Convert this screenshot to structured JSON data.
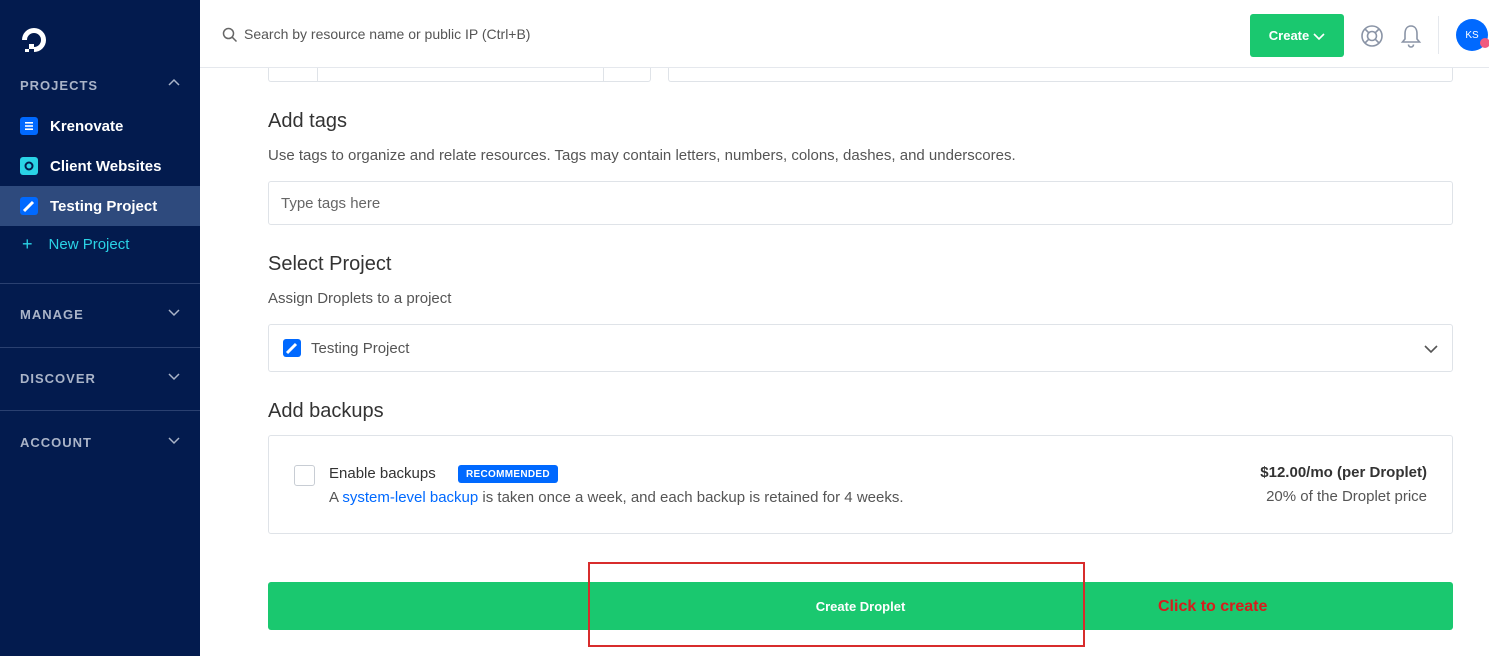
{
  "sidebar": {
    "logo_icon": "digitalocean-logo-icon",
    "projects_header": "PROJECTS",
    "projects": [
      {
        "label": "Krenovate",
        "icon": "project-list-icon",
        "color": "#0069ff"
      },
      {
        "label": "Client Websites",
        "icon": "project-web-icon",
        "color": "#2ad3e6"
      },
      {
        "label": "Testing Project",
        "icon": "project-pencil-icon",
        "color": "#0069ff",
        "active": true
      }
    ],
    "new_project_label": "New Project",
    "manage_header": "MANAGE",
    "discover_header": "DISCOVER",
    "account_header": "ACCOUNT"
  },
  "topbar": {
    "search_placeholder": "Search by resource name or public IP (Ctrl+B)",
    "create_label": "Create",
    "avatar_initials": "KS"
  },
  "tags": {
    "title": "Add tags",
    "description": "Use tags to organize and relate resources. Tags may contain letters, numbers, colons, dashes, and underscores.",
    "placeholder": "Type tags here"
  },
  "project_select": {
    "title": "Select Project",
    "description": "Assign Droplets to a project",
    "selected": "Testing Project"
  },
  "backups": {
    "title": "Add backups",
    "enable_label": "Enable backups",
    "badge": "RECOMMENDED",
    "desc_prefix": "A ",
    "desc_link": "system-level backup",
    "desc_suffix": " is taken once a week, and each backup is retained for 4 weeks.",
    "price": "$12.00/mo (per Droplet)",
    "price_note": "20% of the Droplet price"
  },
  "submit": {
    "label": "Create Droplet",
    "annotation": "Click to create"
  },
  "colors": {
    "sidebar_bg": "#031b4e",
    "accent_green": "#1ac86f",
    "accent_blue": "#0069ff",
    "annotation_red": "#d81c1c"
  }
}
